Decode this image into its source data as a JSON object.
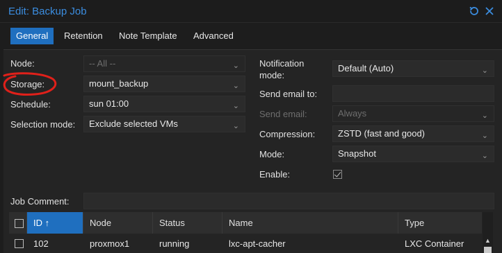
{
  "window": {
    "title": "Edit: Backup Job",
    "reset_icon": "reset-icon",
    "close_icon": "close-icon"
  },
  "tabs": [
    "General",
    "Retention",
    "Note Template",
    "Advanced"
  ],
  "form_left": {
    "node": {
      "label": "Node:",
      "value": "-- All --"
    },
    "storage": {
      "label": "Storage:",
      "value": "mount_backup"
    },
    "schedule": {
      "label": "Schedule:",
      "value": "sun 01:00"
    },
    "selection_mode": {
      "label": "Selection mode:",
      "value": "Exclude selected VMs"
    }
  },
  "form_right": {
    "notification_mode": {
      "label_line1": "Notification",
      "label_line2": "mode:",
      "value": "Default (Auto)"
    },
    "send_email_to": {
      "label": "Send email to:",
      "value": ""
    },
    "send_email": {
      "label": "Send email:",
      "value": "Always"
    },
    "compression": {
      "label": "Compression:",
      "value": "ZSTD (fast and good)"
    },
    "mode": {
      "label": "Mode:",
      "value": "Snapshot"
    },
    "enable": {
      "label": "Enable:",
      "checked": true
    }
  },
  "job_comment": {
    "label": "Job Comment:",
    "value": ""
  },
  "grid": {
    "columns": [
      "ID ↑",
      "Node",
      "Status",
      "Name",
      "Type"
    ],
    "rows": [
      {
        "id": "102",
        "node": "proxmox1",
        "status": "running",
        "name": "lxc-apt-cacher",
        "type": "LXC Container"
      }
    ]
  },
  "colors": {
    "accent": "#1f6fbf",
    "title": "#3b8de0",
    "annotation": "#e0201a"
  }
}
